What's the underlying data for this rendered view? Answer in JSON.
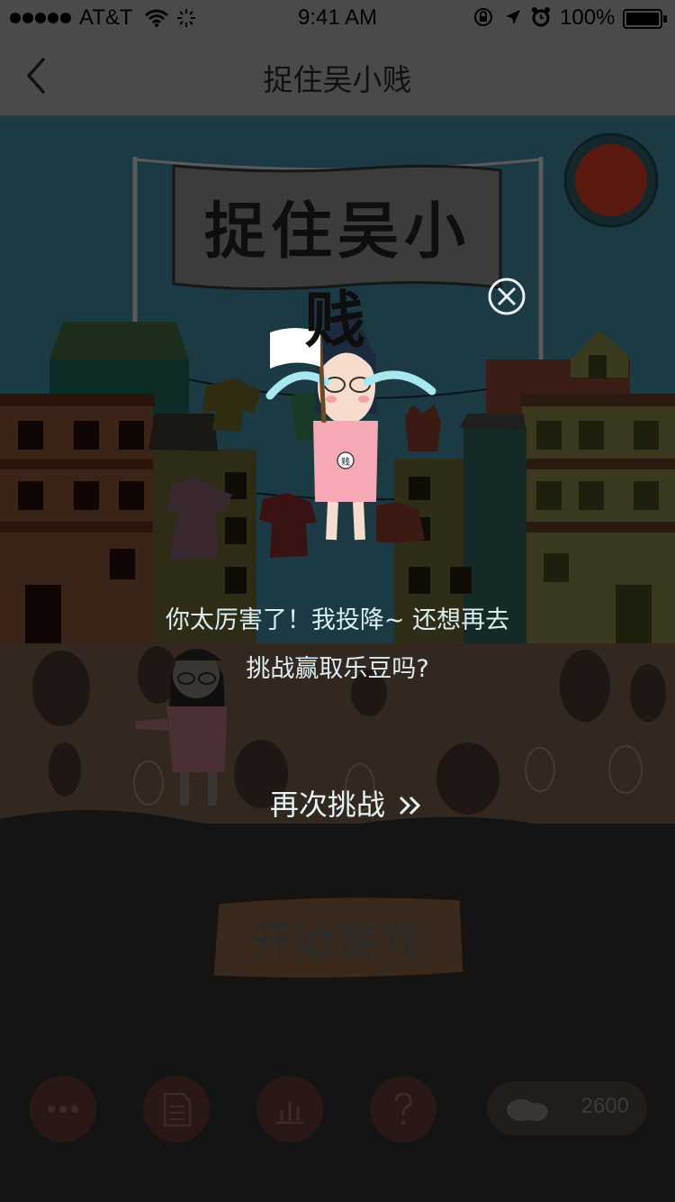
{
  "status_bar": {
    "carrier": "AT&T",
    "time": "9:41 AM",
    "battery": "100%",
    "icons": [
      "signal-dots-icon",
      "wifi-icon",
      "activity-spinner-icon",
      "rotation-lock-icon",
      "location-arrow-icon",
      "alarm-icon",
      "battery-icon"
    ]
  },
  "nav": {
    "title": "捉住吴小贱",
    "back_icon": "chevron-left-icon"
  },
  "scene": {
    "banner_text": "捉住吴小贱",
    "badge_text": "贱",
    "close_icon": "close-circle-icon"
  },
  "dialog": {
    "line1": "你太厉害了！我投降~ 还想再去",
    "line2": "挑战赢取乐豆吗?",
    "retry_label": "再次挑战",
    "retry_icon": "double-chevron-right-icon"
  },
  "start_button": {
    "label": "开始游戏"
  },
  "bottom_bar": {
    "buttons": [
      {
        "icon": "more-dots-icon"
      },
      {
        "icon": "document-icon"
      },
      {
        "icon": "bar-chart-icon"
      },
      {
        "icon": "question-icon"
      }
    ],
    "beans_icon": "beans-icon",
    "beans_count": "2600"
  },
  "colors": {
    "sky": "#1c3a44",
    "ground": "#33281f",
    "overlay": "#000000",
    "dialog_text": "#dceff2",
    "start_button": "#3a2a1e"
  }
}
